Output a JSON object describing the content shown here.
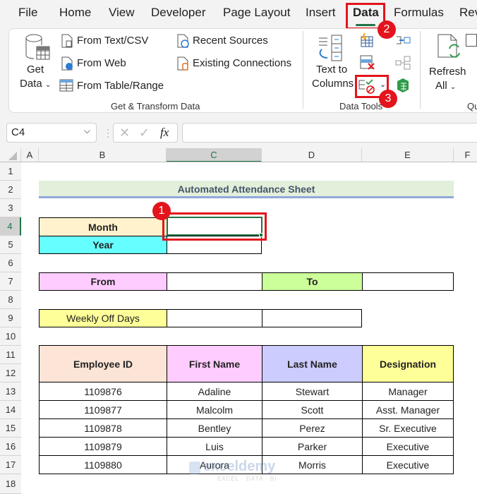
{
  "menu": {
    "tabs": [
      "File",
      "Home",
      "View",
      "Developer",
      "Page Layout",
      "Insert",
      "Data",
      "Formulas",
      "Rev"
    ],
    "active": "Data"
  },
  "ribbon": {
    "get_data_line1": "Get",
    "get_data_line2": "Data",
    "from_text_csv": "From Text/CSV",
    "from_web": "From Web",
    "from_table_range": "From Table/Range",
    "recent_sources": "Recent Sources",
    "existing_connections": "Existing Connections",
    "group_get_transform": "Get & Transform Data",
    "text_to_line1": "Text to",
    "text_to_line2": "Columns",
    "group_data_tools": "Data Tools",
    "refresh_line1": "Refresh",
    "refresh_line2": "All",
    "group_queries": "Qu"
  },
  "callouts": {
    "one": "1",
    "two": "2",
    "three": "3"
  },
  "formula_bar": {
    "name_box": "C4",
    "formula": "",
    "fx": "fx"
  },
  "columns": [
    "A",
    "B",
    "C",
    "D",
    "E",
    "F"
  ],
  "selected_column": "C",
  "rows": [
    "1",
    "2",
    "3",
    "4",
    "5",
    "6",
    "7",
    "8",
    "9",
    "10",
    "11",
    "12",
    "13",
    "14",
    "15",
    "16",
    "17",
    "18"
  ],
  "selected_row": "4",
  "sheet": {
    "title": "Automated Attendance Sheet",
    "month_label": "Month",
    "year_label": "Year",
    "from_label": "From",
    "to_label": "To",
    "weekly_off_label": "Weekly Off Days",
    "table": {
      "headers": [
        "Employee ID",
        "First Name",
        "Last Name",
        "Designation"
      ],
      "rows": [
        [
          "1109876",
          "Adaline",
          "Stewart",
          "Manager"
        ],
        [
          "1109877",
          "Malcolm",
          "Scott",
          "Asst. Manager"
        ],
        [
          "1109878",
          "Bentley",
          "Perez",
          "Sr. Executive"
        ],
        [
          "1109879",
          "Luis",
          "Parker",
          "Executive"
        ],
        [
          "1109880",
          "Aurora",
          "Morris",
          "Executive"
        ]
      ]
    }
  },
  "watermark": {
    "brand": "exceldemy",
    "tagline": "EXCEL · DATA · BI"
  },
  "colors": {
    "accent": "#217346",
    "callout": "#e3141b",
    "title_bg": "#e2efda",
    "month_bg": "#fff2cc",
    "year_bg": "#66ffff",
    "from_bg": "#ffccff",
    "to_bg": "#ccff99",
    "weekly_bg": "#ffff99",
    "hdr_empid": "#fce4d6",
    "hdr_first": "#ffccff",
    "hdr_last": "#ccccff",
    "hdr_desig": "#ffff99"
  }
}
